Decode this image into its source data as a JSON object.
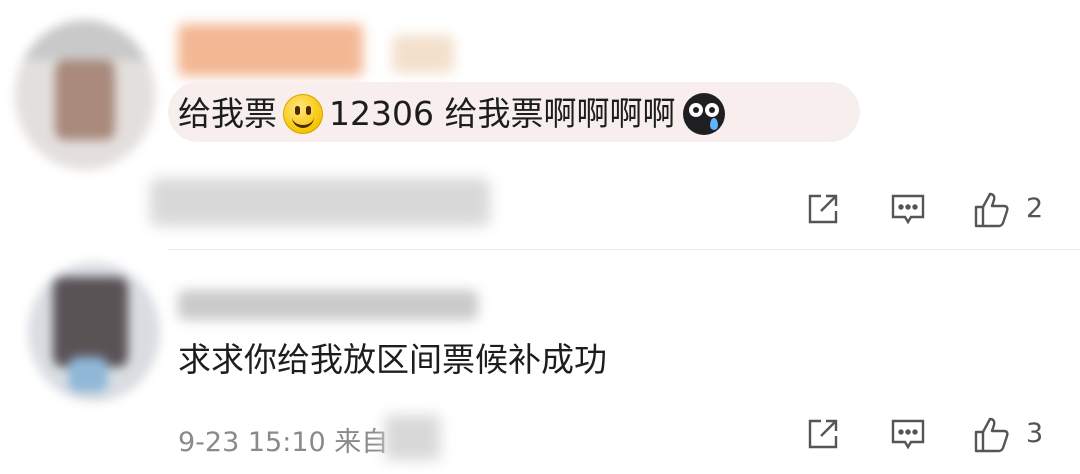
{
  "comments": [
    {
      "text_part1": "给我票",
      "text_part2": "12306 给我票啊啊啊啊",
      "emojis": [
        "smile-emoji",
        "crying-emoji"
      ],
      "likes": "2"
    },
    {
      "text": "求求你给我放区间票候补成功",
      "timestamp": "9-23 15:10",
      "source_prefix": "来自",
      "likes": "3"
    }
  ],
  "colors": {
    "bubble_bg": "#f8eeee",
    "text": "#1d1d1d",
    "meta": "#8a8a8a",
    "icon": "#555555"
  }
}
